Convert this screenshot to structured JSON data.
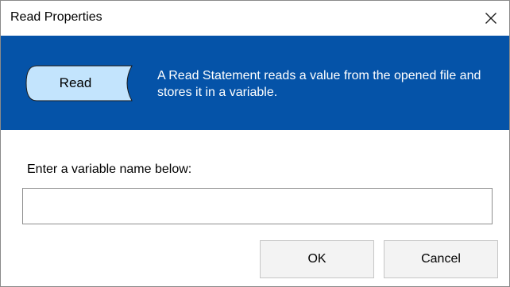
{
  "window": {
    "title": "Read Properties",
    "close_icon": "close-icon"
  },
  "banner": {
    "background_color": "#0553a8",
    "shape_label": "Read",
    "shape_fill_color": "#c3e4fd",
    "description": "A Read Statement reads a value from the opened file and stores it in a variable."
  },
  "form": {
    "prompt_label": "Enter a variable name below:",
    "variable_name_value": "",
    "variable_name_placeholder": ""
  },
  "buttons": {
    "ok_label": "OK",
    "cancel_label": "Cancel"
  }
}
